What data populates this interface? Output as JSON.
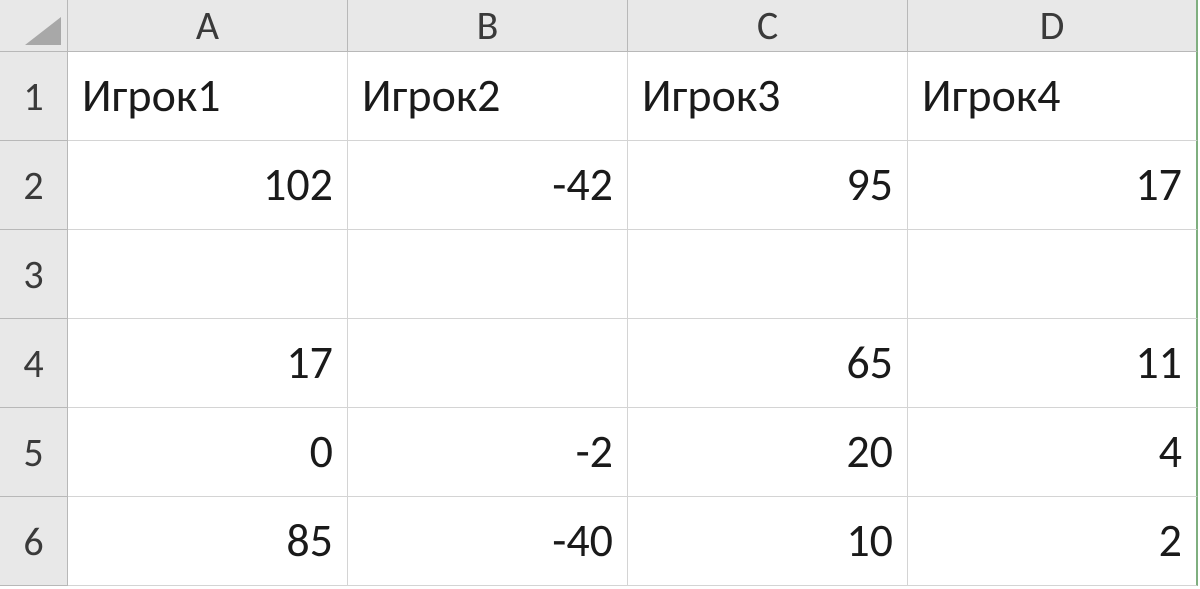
{
  "columns": [
    "A",
    "B",
    "C",
    "D"
  ],
  "rowNumbers": [
    "1",
    "2",
    "3",
    "4",
    "5",
    "6"
  ],
  "cells": {
    "r1": {
      "A": "Игрок1",
      "B": "Игрок2",
      "C": "Игрок3",
      "D": "Игрок4"
    },
    "r2": {
      "A": "102",
      "B": "-42",
      "C": "95",
      "D": "17"
    },
    "r3": {
      "A": "",
      "B": "",
      "C": "",
      "D": ""
    },
    "r4": {
      "A": "17",
      "B": "",
      "C": "65",
      "D": "11"
    },
    "r5": {
      "A": "0",
      "B": "-2",
      "C": "20",
      "D": "4"
    },
    "r6": {
      "A": "85",
      "B": "-40",
      "C": "10",
      "D": "2"
    }
  }
}
